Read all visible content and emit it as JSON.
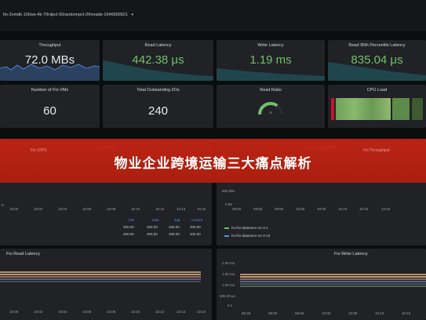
{
  "header": {
    "dashboard_title": "fio-2vmdk-100ws-4k-70rdpct-50randompct-2threads-1646699921",
    "caret": "▾"
  },
  "stats": [
    {
      "title": "Throughput",
      "value": "72.0 MBs",
      "color": "white"
    },
    {
      "title": "Read Latency",
      "value": "442.38 μs",
      "color": "green"
    },
    {
      "title": "Write Latency",
      "value": "1.19 ms",
      "color": "green"
    },
    {
      "title": "Read 95th Percentile Latency",
      "value": "835.04 μs",
      "color": "green"
    },
    {
      "title": "Number of Fio VMs",
      "value": "60",
      "color": "white"
    },
    {
      "title": "Total Outstanding I/Os",
      "value": "240",
      "color": "white"
    }
  ],
  "read_ratio": {
    "title": "Read Ratio",
    "value": "70",
    "percent": 70
  },
  "cpu_load": {
    "title": "CPU Load"
  },
  "banner": {
    "title": "物业企业跨境运输三大痛点解析"
  },
  "graphs": {
    "iops": {
      "title": "Fio IOPS"
    },
    "throughput": {
      "title": "Fio Throughput",
      "y_ticks": [
        "1.0 kBs",
        "500 kBs",
        "0 Bs"
      ],
      "x_ticks": [
        "09:50",
        "09:50",
        "09:55",
        "10:00",
        "10:05",
        "10:10",
        "10:15",
        "10:16"
      ],
      "legend": [
        {
          "label": "hci-fio-datastore-21-0-1",
          "color": "#73bf69"
        },
        {
          "label": "hci-fio-datastore-21-0-10",
          "color": "#5794f2"
        }
      ]
    },
    "left_top": {
      "y_tick": "0",
      "x_ticks": [
        "10:00",
        "10:02",
        "10:04",
        "10:06",
        "10:08",
        "10:10",
        "10:12",
        "10:14",
        "10:16"
      ]
    },
    "summary_table": {
      "headers": [
        "min",
        "max",
        "avg",
        "current"
      ],
      "rows": [
        [
          "300.00",
          "300.00",
          "300.00",
          "300.00"
        ],
        [
          "300.00",
          "300.00",
          "300.00",
          "300.00"
        ]
      ]
    },
    "read_latency": {
      "title": "Fio Read Latency",
      "x_ticks": [
        "10:00",
        "10:02",
        "10:04",
        "10:06",
        "10:08",
        "10:10",
        "10:12",
        "10:14",
        "10:16"
      ]
    },
    "write_latency": {
      "title": "Fio Write Latency",
      "y_ticks": [
        "2.00 ms",
        "1.50 ms",
        "1.00 ms",
        "500.00 μs",
        "0 s"
      ],
      "x_ticks": [
        "09:45",
        "09:50",
        "09:55",
        "10:00",
        "10:05",
        "10:10",
        "10:15"
      ]
    }
  },
  "colors": {
    "accent_green": "#73bf69",
    "accent_blue": "#5794f2",
    "banner_red": "#c62414",
    "panel": "#202226",
    "background": "#0b0c0e"
  }
}
